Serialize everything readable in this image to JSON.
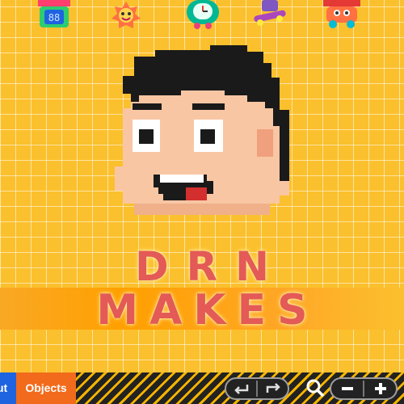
{
  "title": {
    "line1": "DRN",
    "line2": "MAKES"
  },
  "toolbar": {
    "tab_layout": "Layout",
    "tab_layout_visible": "ut",
    "tab_objects": "Objects"
  },
  "icons": {
    "stickers": [
      "robot-sticker-icon",
      "flower-sticker-icon",
      "clock-sticker-icon",
      "skateboard-sticker-icon",
      "car-sticker-icon"
    ],
    "undo": "undo-icon",
    "redo": "redo-icon",
    "zoom": "magnifier-icon",
    "zoom_out": "minus-icon",
    "zoom_in": "plus-icon"
  },
  "colors": {
    "background": "#fbc02d",
    "title": "#e35a56",
    "tab_layout": "#1e63e0",
    "tab_objects": "#f26a1b"
  }
}
